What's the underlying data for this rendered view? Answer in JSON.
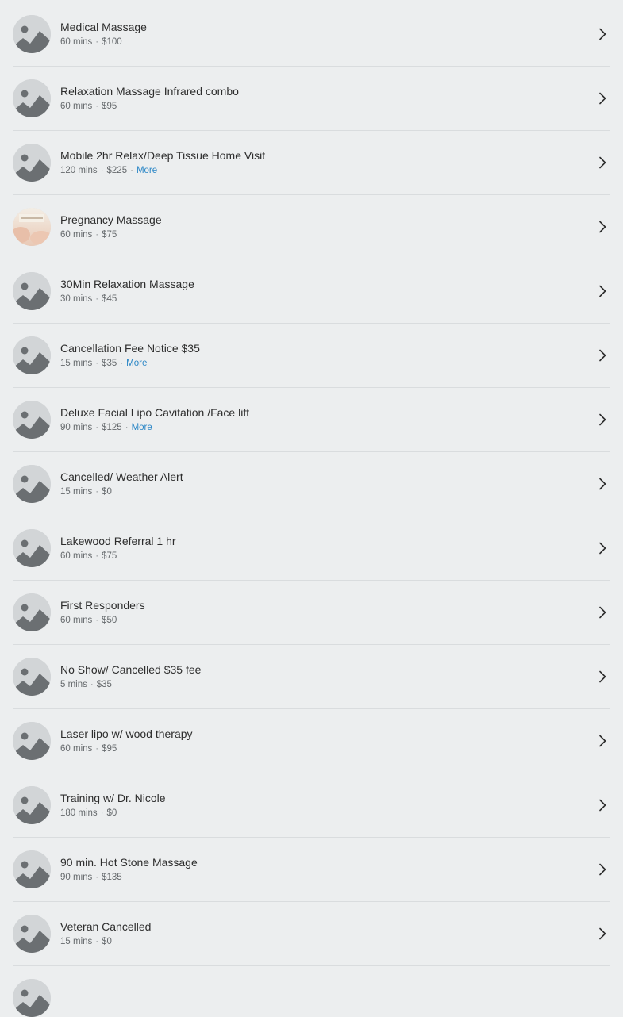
{
  "services": [
    {
      "name": "Medical Massage",
      "duration": "60 mins",
      "price": "$100",
      "more": "",
      "image": "placeholder-image-icon"
    },
    {
      "name": "Relaxation Massage Infrared combo",
      "duration": "60 mins",
      "price": "$95",
      "more": "",
      "image": "placeholder-image-icon"
    },
    {
      "name": "Mobile 2hr Relax/Deep Tissue Home Visit",
      "duration": "120 mins",
      "price": "$225",
      "more": "More",
      "image": "placeholder-image-icon"
    },
    {
      "name": "Pregnancy Massage",
      "duration": "60 mins",
      "price": "$75",
      "more": "",
      "image": "photo"
    },
    {
      "name": "30Min Relaxation Massage",
      "duration": "30 mins",
      "price": "$45",
      "more": "",
      "image": "placeholder-image-icon"
    },
    {
      "name": "Cancellation Fee Notice $35",
      "duration": "15 mins",
      "price": "$35",
      "more": "More",
      "image": "placeholder-image-icon"
    },
    {
      "name": "Deluxe Facial Lipo Cavitation /Face lift",
      "duration": "90 mins",
      "price": "$125",
      "more": "More",
      "image": "placeholder-image-icon"
    },
    {
      "name": "Cancelled/ Weather Alert",
      "duration": "15 mins",
      "price": "$0",
      "more": "",
      "image": "placeholder-image-icon"
    },
    {
      "name": "Lakewood Referral 1 hr",
      "duration": "60 mins",
      "price": "$75",
      "more": "",
      "image": "placeholder-image-icon"
    },
    {
      "name": "First Responders",
      "duration": "60 mins",
      "price": "$50",
      "more": "",
      "image": "placeholder-image-icon"
    },
    {
      "name": "No Show/ Cancelled $35 fee",
      "duration": "5 mins",
      "price": "$35",
      "more": "",
      "image": "placeholder-image-icon"
    },
    {
      "name": "Laser lipo w/ wood therapy",
      "duration": "60 mins",
      "price": "$95",
      "more": "",
      "image": "placeholder-image-icon"
    },
    {
      "name": "Training w/ Dr. Nicole",
      "duration": "180 mins",
      "price": "$0",
      "more": "",
      "image": "placeholder-image-icon"
    },
    {
      "name": "90 min. Hot Stone Massage",
      "duration": "90 mins",
      "price": "$135",
      "more": "",
      "image": "placeholder-image-icon"
    },
    {
      "name": "Veteran Cancelled",
      "duration": "15 mins",
      "price": "$0",
      "more": "",
      "image": "placeholder-image-icon"
    }
  ],
  "separator": "·",
  "colors": {
    "background": "#eceeef",
    "link": "#2a86c6",
    "title": "#2d2d2d",
    "meta": "#666a6d"
  }
}
